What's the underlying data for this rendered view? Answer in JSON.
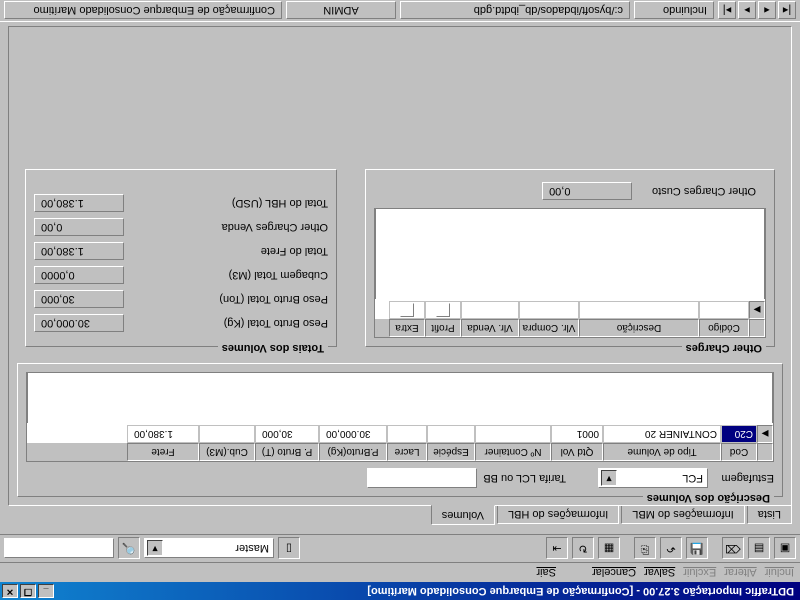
{
  "window": {
    "title": "DDTraffic Importação 3.27.00 - [Confirmação de Embarque Consolidado Marítimo]"
  },
  "menu": {
    "incluir": "Incluir",
    "alterar": "Alterar",
    "excluir": "Excluir",
    "salvar": "Salvar",
    "cancelar": "Cancelar",
    "sair": "Sair"
  },
  "toolbar": {
    "master_label": "Master",
    "blank_field": ""
  },
  "tabs": {
    "lista": "Lista",
    "info_mbl": "Informações do MBL",
    "info_hbl": "Informações do HBL",
    "volumes": "Volumes"
  },
  "volumes_group": {
    "legend": "Descrição dos Volumes",
    "estufagem_label": "Estufagem",
    "estufagem_value": "FCL",
    "tarifa_label": "Tarifa LCL ou BB",
    "tarifa_value": "",
    "columns": {
      "cod": "Cod",
      "tipo": "Tipo de Volume",
      "qtd": "Qtd Vol",
      "ncont": "Nº Container",
      "especie": "Espécie",
      "lacre": "Lacre",
      "pbruto_kg": "P.Bruto(Kg)",
      "pbruto_t": "P. Bruto (T)",
      "cub": "Cub.(M3)",
      "frete": "Frete"
    },
    "rows": [
      {
        "cod": "C20",
        "tipo": "CONTAINER 20",
        "qtd": "0001",
        "ncont": "",
        "especie": "",
        "lacre": "",
        "pbruto_kg": "30.000,00",
        "pbruto_t": "30,000",
        "cub": "",
        "frete": "1.380,00"
      }
    ]
  },
  "other_charges": {
    "legend": "Other Charges",
    "columns": {
      "codigo": "Código",
      "descricao": "Descrição",
      "vlr_compra": "Vlr. Compra",
      "vlr_venda": "Vlr. Venda",
      "profit": "Profit",
      "extra": "Extra"
    },
    "custo_label": "Other Charges Custo",
    "custo_value": "0,00"
  },
  "totais": {
    "legend": "Totais dos Volumes",
    "rows": {
      "peso_kg": {
        "label": "Peso Bruto Total (Kg)",
        "value": "30.000,00"
      },
      "peso_ton": {
        "label": "Peso Bruto Total (Ton)",
        "value": "30,000"
      },
      "cubagem": {
        "label": "Cubagem Total (M3)",
        "value": "0,0000"
      },
      "frete": {
        "label": "Total do Frete",
        "value": "1.380,00"
      },
      "oc_venda": {
        "label": "Other Charges Venda",
        "value": "0,00"
      },
      "hbl_usd": {
        "label": "Total do HBL (USD)",
        "value": "1.380,00"
      }
    }
  },
  "status": {
    "mode": "Incluindo",
    "user": "ADMIN",
    "db": "c:/bysoft/ibdados/db_ibdtd.gdb",
    "doc": "Confirmação de Embarque Consolidado Marítimo"
  }
}
